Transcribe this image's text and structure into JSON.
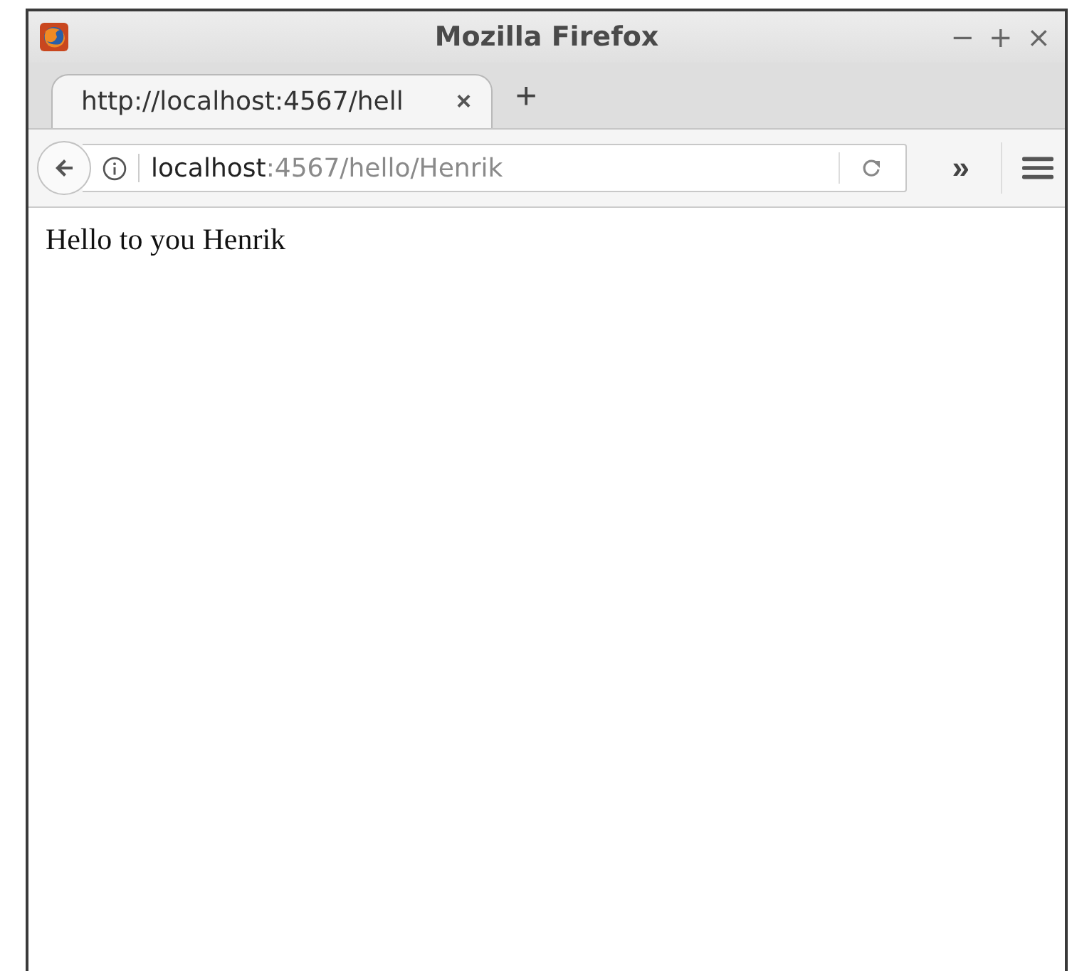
{
  "window": {
    "title": "Mozilla Firefox",
    "controls": [
      "−",
      "+",
      "×"
    ]
  },
  "tabs": [
    {
      "label": "http://localhost:4567/hell",
      "selected": true,
      "close": "×"
    }
  ],
  "new_tab": "+",
  "url": {
    "host": "localhost",
    "path": ":4567/hello/Henrik"
  },
  "overflow": "»",
  "content": {
    "text": "Hello to you Henrik"
  }
}
